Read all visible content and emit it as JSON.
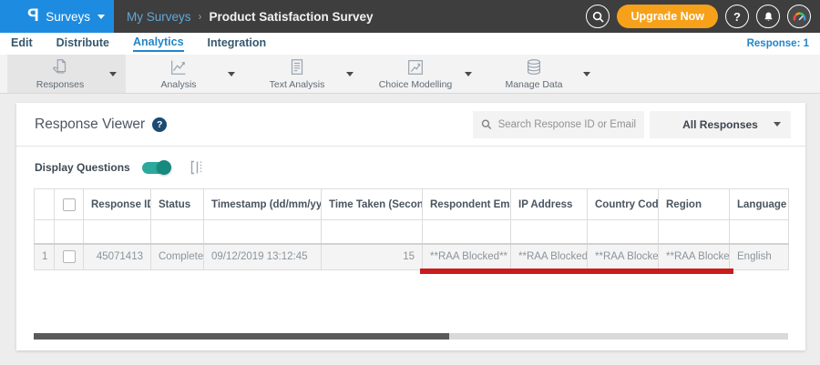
{
  "topbar": {
    "logo_letter": "P",
    "workspace": "Surveys",
    "breadcrumb_parent": "My Surveys",
    "breadcrumb_separator": "›",
    "breadcrumb_current": "Product Satisfaction Survey",
    "upgrade_label": "Upgrade Now",
    "help_label": "?"
  },
  "nav": {
    "items": [
      {
        "label": "Edit"
      },
      {
        "label": "Distribute"
      },
      {
        "label": "Analytics"
      },
      {
        "label": "Integration"
      }
    ],
    "response_count_label": "Response: 1"
  },
  "ribbon": {
    "tabs": [
      {
        "label": "Responses"
      },
      {
        "label": "Analysis"
      },
      {
        "label": "Text Analysis"
      },
      {
        "label": "Choice Modelling"
      },
      {
        "label": "Manage Data"
      }
    ]
  },
  "viewer": {
    "title": "Response Viewer",
    "help_label": "?",
    "search_placeholder": "Search Response ID or Email",
    "responses_filter": "All Responses",
    "display_questions_label": "Display Questions"
  },
  "table": {
    "headers": {
      "response_id": "Response ID",
      "status": "Status",
      "timestamp": "Timestamp (dd/mm/yyyy)",
      "time_taken": "Time Taken (Seconds)",
      "respondent_email": "Respondent Email",
      "ip_address": "IP Address",
      "country_code": "Country Code",
      "region": "Region",
      "language": "Language"
    },
    "rows": [
      {
        "num": "1",
        "response_id": "45071413",
        "status": "Completed",
        "timestamp": "09/12/2019 13:12:45",
        "time_taken": "15",
        "respondent_email": "**RAA Blocked**",
        "ip_address": "**RAA Blocked**",
        "country_code": "**RAA Blocked**",
        "region": "**RAA Blocked**",
        "language": "English"
      }
    ]
  },
  "colors": {
    "brand_blue": "#1d8ce0",
    "topbar_dark": "#3e3e3e",
    "upgrade_orange": "#f7a11a",
    "link_blue": "#2386c8",
    "toggle_teal": "#2ba99d",
    "annotation_red": "#cb1b1b"
  }
}
